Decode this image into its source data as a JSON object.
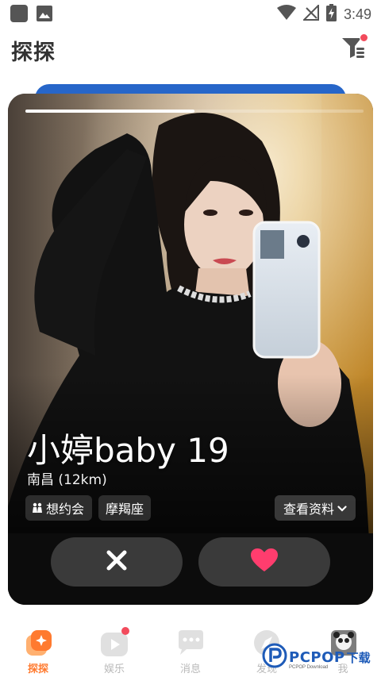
{
  "status_bar": {
    "time": "3:49",
    "icons": [
      "app-square-icon",
      "image-icon",
      "wifi-icon",
      "no-signal-icon",
      "battery-charging-icon"
    ]
  },
  "header": {
    "title": "探探",
    "filter_icon": "filter-icon",
    "filter_has_badge": true
  },
  "card": {
    "photo_progress": 0.5,
    "name": "小婷baby 19",
    "location": "南昌 (12km)",
    "tags": [
      {
        "icon": "couple-icon",
        "label": "想约会"
      },
      {
        "label": "摩羯座"
      }
    ],
    "view_profile_label": "查看资料",
    "dislike_icon": "close-icon",
    "like_icon": "heart-icon"
  },
  "bottom_nav": {
    "items": [
      {
        "label": "探探",
        "icon": "tantan-icon",
        "active": true
      },
      {
        "label": "娱乐",
        "icon": "play-icon",
        "badge": true
      },
      {
        "label": "消息",
        "icon": "chat-icon"
      },
      {
        "label": "发现",
        "icon": "discover-icon"
      },
      {
        "label": "我",
        "icon": "avatar"
      }
    ]
  },
  "watermark": {
    "brand": "PCPOP",
    "cn": "下载",
    "sub": "PCPOP Download"
  },
  "colors": {
    "accent": "#ff7a2f",
    "like": "#ff3d6e",
    "badge": "#f24b5c",
    "nav_inactive": "#b9b9b9"
  }
}
